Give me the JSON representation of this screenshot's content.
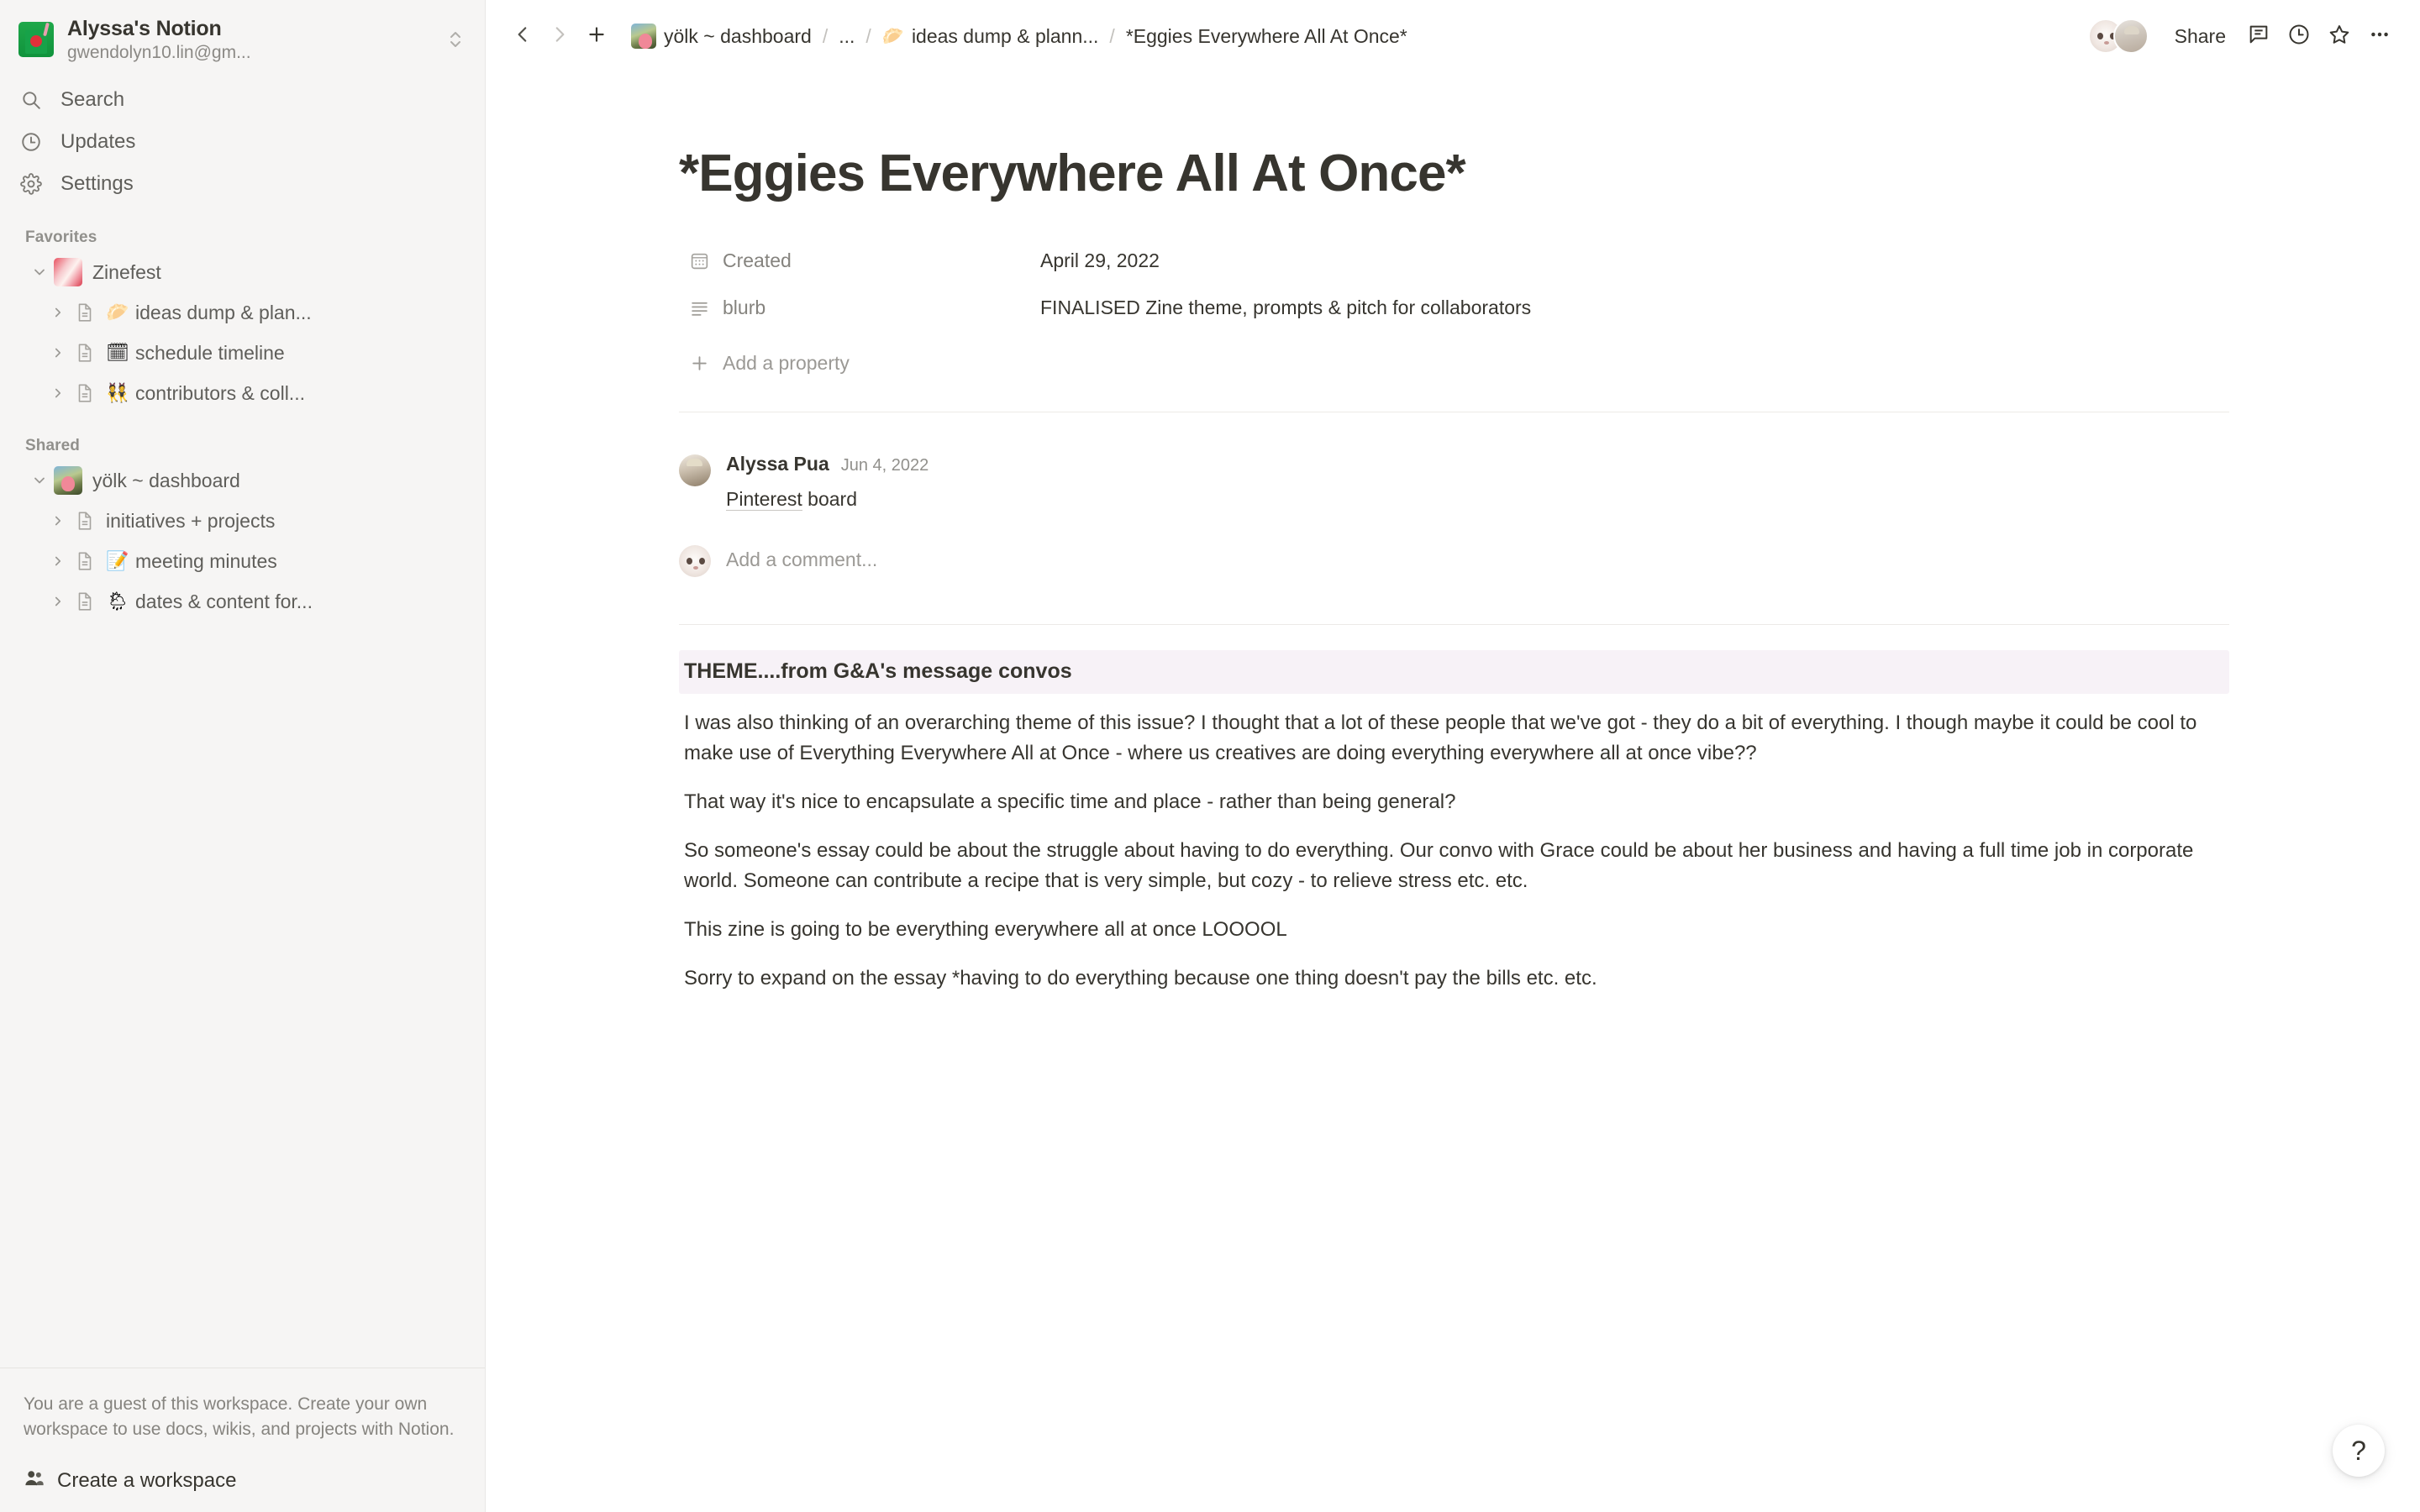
{
  "sidebar": {
    "workspace": {
      "name": "Alyssa's Notion",
      "email": "gwendolyn10.lin@gm...",
      "icon": "juicebox-emoji"
    },
    "nav": [
      {
        "label": "Search",
        "icon": "search-icon"
      },
      {
        "label": "Updates",
        "icon": "clock-icon"
      },
      {
        "label": "Settings",
        "icon": "gear-icon"
      }
    ],
    "favorites": {
      "title": "Favorites",
      "root": {
        "label": "Zinefest",
        "icon": "zinefest-thumbnail"
      },
      "children": [
        {
          "emoji": "🥟",
          "label": "ideas dump & plan..."
        },
        {
          "emoji": "🗓",
          "label": "schedule timeline"
        },
        {
          "emoji": "👯",
          "label": "contributors & coll..."
        }
      ]
    },
    "shared": {
      "title": "Shared",
      "root": {
        "label": "yölk ~ dashboard",
        "icon": "yolk-thumbnail"
      },
      "children": [
        {
          "emoji": "",
          "label": "initiatives + projects"
        },
        {
          "emoji": "📝",
          "label": "meeting minutes"
        },
        {
          "emoji": "🌦",
          "label": "dates & content for..."
        }
      ]
    },
    "guest_notice": "You are a guest of this workspace. Create your own workspace to use docs, wikis, and projects with Notion.",
    "create_workspace_label": "Create a workspace"
  },
  "topbar": {
    "back_icon": "chevron-left-icon",
    "forward_icon": "chevron-right-icon",
    "new_page_icon": "plus-icon",
    "breadcrumbs": [
      {
        "emoji": "",
        "label": "yölk ~ dashboard",
        "thumb": "yolk-thumbnail"
      },
      {
        "emoji": "",
        "label": "...",
        "thumb": ""
      },
      {
        "emoji": "🥟",
        "label": "ideas dump & plann...",
        "thumb": ""
      },
      {
        "emoji": "",
        "label": "*Eggies Everywhere All At Once*",
        "thumb": ""
      }
    ],
    "share_label": "Share",
    "comment_icon": "comment-icon",
    "history_icon": "clock-icon",
    "favorite_icon": "star-icon",
    "more_icon": "more-horizontal-icon"
  },
  "page": {
    "title": "*Eggies Everywhere All At Once*",
    "properties": [
      {
        "icon": "calendar-icon",
        "name": "Created",
        "value": "April 29, 2022"
      },
      {
        "icon": "text-lines-icon",
        "name": "blurb",
        "value": "FINALISED Zine theme, prompts & pitch for collaborators"
      }
    ],
    "add_property_label": "Add a property",
    "comment": {
      "author": "Alyssa Pua",
      "date": "Jun 4, 2022",
      "link_text": "Pinterest",
      "rest_text": " board"
    },
    "add_comment_placeholder": "Add a comment...",
    "heading": "THEME....from G&A's message convos",
    "heading_bg": "#f7f2f7",
    "paragraphs": [
      "I was also thinking of an overarching theme of this issue? I thought that a lot of these people that we've got - they do a bit of everything. I though maybe it could be cool to make use of Everything Everywhere All at Once - where us creatives are doing everything everywhere all at once vibe??",
      "That way it's nice to encapsulate a specific time and place - rather than being general?",
      "So someone's essay could be about the struggle about having to do everything. Our convo with Grace could be about her business and having a full time job in corporate world. Someone can contribute a recipe that is very simple, but cozy - to relieve stress etc. etc.",
      "This zine is going to be everything everywhere all at once LOOOOL",
      "Sorry to expand on the essay *having to do everything because one thing doesn't pay the bills etc. etc."
    ]
  },
  "help_button_label": "?"
}
